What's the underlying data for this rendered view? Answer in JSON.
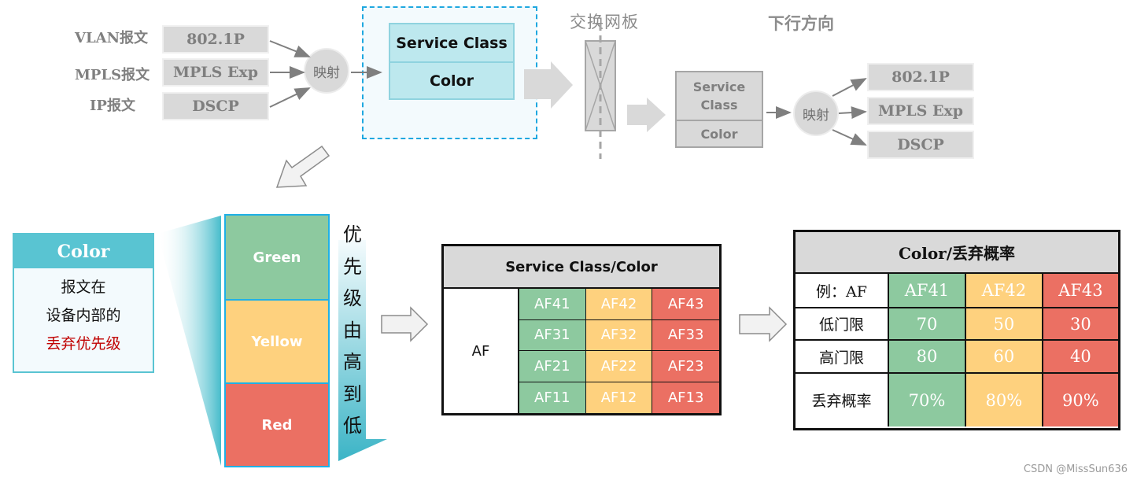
{
  "upstream": {
    "packet_labels": [
      "VLAN报文",
      "MPLS报文",
      "IP报文"
    ],
    "fields": [
      "802.1P",
      "MPLS Exp",
      "DSCP"
    ],
    "map_label": "映射",
    "internal_box": {
      "row1": "Service Class",
      "row2": "Color"
    }
  },
  "switch_fabric": {
    "title": "交换网板"
  },
  "downstream": {
    "title": "下行方向",
    "internal_box": {
      "row1_line1": "Service",
      "row1_line2": "Class",
      "row2": "Color"
    },
    "map_label": "映射",
    "fields": [
      "802.1P",
      "MPLS Exp",
      "DSCP"
    ]
  },
  "color_card": {
    "header": "Color",
    "lines": [
      "报文在",
      "设备内部的",
      "丢弃优先级"
    ]
  },
  "color_stack": {
    "cells": [
      {
        "label": "Green",
        "color": "#8dc99f"
      },
      {
        "label": "Yellow",
        "color": "#fed17e"
      },
      {
        "label": "Red",
        "color": "#eb7063"
      }
    ],
    "priority_chars": [
      "优",
      "先",
      "级",
      "由",
      "高",
      "到",
      "低"
    ]
  },
  "service_class_table": {
    "header": "Service Class/Color",
    "row_label": "AF",
    "rows": [
      [
        "AF41",
        "AF42",
        "AF43"
      ],
      [
        "AF31",
        "AF32",
        "AF33"
      ],
      [
        "AF21",
        "AF22",
        "AF23"
      ],
      [
        "AF11",
        "AF12",
        "AF13"
      ]
    ],
    "column_colors": [
      "#8dc99f",
      "#fed17e",
      "#eb7063"
    ]
  },
  "drop_table": {
    "header": "Color/丢弃概率",
    "rows": [
      {
        "label": "例：AF",
        "values": [
          "AF41",
          "AF42",
          "AF43"
        ]
      },
      {
        "label": "低门限",
        "values": [
          "70",
          "50",
          "30"
        ]
      },
      {
        "label": "高门限",
        "values": [
          "80",
          "60",
          "40"
        ]
      },
      {
        "label": "丢弃概率",
        "values": [
          "70%",
          "80%",
          "90%"
        ]
      }
    ],
    "column_colors": [
      "#8dc99f",
      "#fed17e",
      "#eb7063"
    ]
  },
  "watermark": "CSDN @MissSun636"
}
